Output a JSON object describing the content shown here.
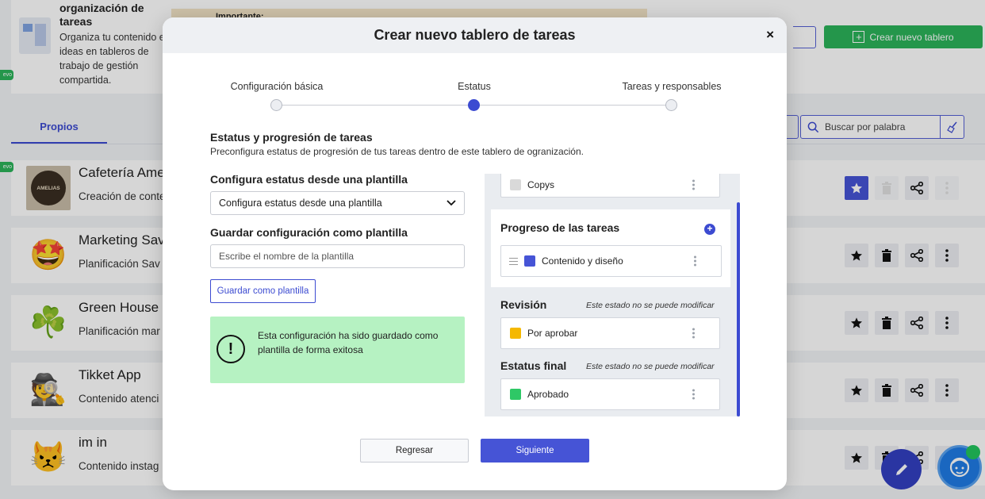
{
  "background": {
    "hero": {
      "title": "organización de tareas",
      "description": "Organiza tu contenido e ideas en tableros de trabajo de gestión compartida.",
      "notice": "Importante:",
      "new_tag": "evo"
    },
    "create_button": "Crear nuevo tablero",
    "tabs": {
      "active": "Propios"
    },
    "search": {
      "placeholder": "Buscar por palabra"
    },
    "boards": [
      {
        "name": "Cafetería Ame",
        "desc": "Creación de conte",
        "logo": "cafe-logo",
        "logo_text": "AMELIAS",
        "starred": true
      },
      {
        "name": "Marketing Sav",
        "desc": "Planificación Sav",
        "logo": "star-struck-emoji",
        "glyph": "🤩"
      },
      {
        "name": "Green House",
        "desc": "Planificación mar",
        "logo": "shamrock-emoji",
        "glyph": "☘️"
      },
      {
        "name": "Tikket App",
        "desc": "Contenido atenci",
        "logo": "detective-emoji",
        "glyph": "🕵️"
      },
      {
        "name": "im in",
        "desc": "Contenido instag",
        "logo": "pouting-cat-emoji",
        "glyph": "😾"
      }
    ]
  },
  "modal": {
    "title": "Crear nuevo tablero de tareas",
    "close_glyph": "×",
    "steps": [
      {
        "label": "Configuración básica",
        "active": false
      },
      {
        "label": "Estatus",
        "active": true
      },
      {
        "label": "Tareas y responsables",
        "active": false
      }
    ],
    "section": {
      "title": "Estatus y progresión de tareas",
      "desc": "Preconfigura estatus de progresión de tus tareas dentro de este tablero de ogranización."
    },
    "template": {
      "label": "Configura estatus desde una plantilla",
      "selected": "Configura estatus desde una plantilla"
    },
    "save_template": {
      "label": "Guardar configuración como plantilla",
      "placeholder": "Escribe el nombre de la plantilla",
      "button": "Guardar como plantilla"
    },
    "success": {
      "icon": "!",
      "text": "Esta configuración ha sido guardado como plantilla de forma exitosa"
    },
    "status_panel": {
      "copys": {
        "label": "Copys",
        "color": "#d9d9d9"
      },
      "progress": {
        "title": "Progreso de las tareas",
        "add_glyph": "+",
        "item": {
          "label": "Contenido y diseño",
          "color": "#3c4bd1"
        }
      },
      "review": {
        "title": "Revisión",
        "note": "Este estado no se puede modificar",
        "item": {
          "label": "Por aprobar",
          "color": "#f5b800"
        }
      },
      "final": {
        "title": "Estatus final",
        "note": "Este estado no se puede modificar",
        "item": {
          "label": "Aprobado",
          "color": "#2ec866"
        }
      }
    },
    "buttons": {
      "back": "Regresar",
      "next": "Siguiente"
    }
  }
}
